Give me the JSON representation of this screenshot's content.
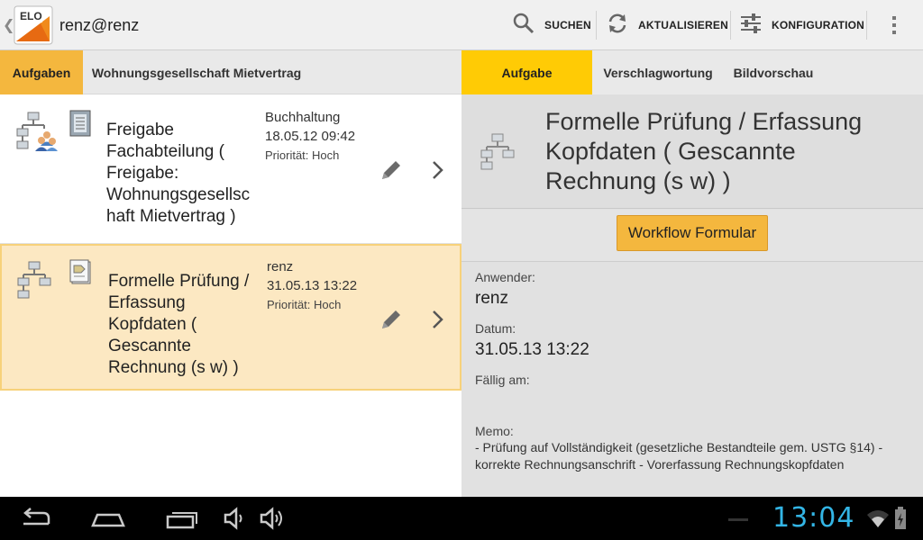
{
  "actionbar": {
    "account": "renz@renz",
    "search_label": "SUCHEN",
    "refresh_label": "AKTUALISIEREN",
    "config_label": "KONFIGURATION",
    "icons": [
      "back-chevron-icon",
      "elo-logo-icon",
      "search-icon",
      "refresh-icon",
      "sliders-icon",
      "overflow-menu-icon"
    ]
  },
  "left_tabs": [
    {
      "label": "Aufgaben",
      "active": true
    },
    {
      "label": "Wohnungsgesellschaft Mietvertrag",
      "active": false
    }
  ],
  "tasks": [
    {
      "title": "Freigabe Fachabteilung ( Freigabe: Wohnungsgesellsc haft Mietvertrag )",
      "user": "Buchhaltung",
      "date": "18.05.12 09:42",
      "priority": "Priorität: Hoch",
      "selected": false
    },
    {
      "title": "Formelle Prüfung / Erfassung Kopfdaten ( Gescannte Rechnung (s w) )",
      "user": "renz",
      "date": "31.05.13 13:22",
      "priority": "Priorität: Hoch",
      "selected": true
    }
  ],
  "right_tabs": [
    {
      "label": "Aufgabe",
      "active": true
    },
    {
      "label": "Verschlagwortung",
      "active": false
    },
    {
      "label": "Bildvorschau",
      "active": false
    }
  ],
  "detail": {
    "title": "Formelle Prüfung / Erfassung Kopfdaten ( Gescannte Rechnung (s w) )",
    "workflow_button": "Workflow Formular",
    "user_label": "Anwender:",
    "user_value": "renz",
    "date_label": "Datum:",
    "date_value": "31.05.13 13:22",
    "due_label": "Fällig am:",
    "due_value": "",
    "memo_label": "Memo:",
    "memo_text": "- Prüfung auf Vollständigkeit (gesetzliche Bestandteile gem. USTG §14) - korrekte Rechnungsanschrift - Vorerfassung Rechnungskopfdaten"
  },
  "systembar": {
    "clock": "13:04",
    "accent": "#33b5e5"
  },
  "colors": {
    "tab_active_left": "#f4b73e",
    "tab_active_right": "#ffcb05",
    "selected_row": "#fce8c2"
  }
}
